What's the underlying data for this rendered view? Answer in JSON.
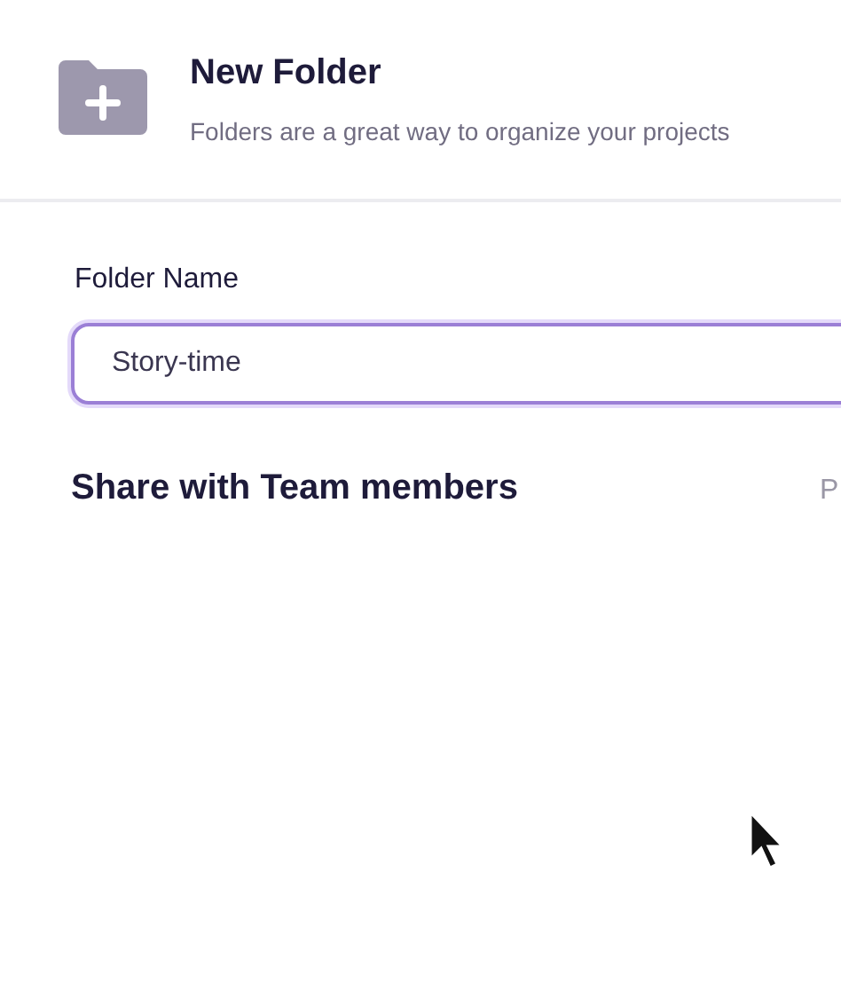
{
  "header": {
    "title": "New Folder",
    "subtitle": "Folders are a great way to organize your projects"
  },
  "folder_name": {
    "label": "Folder Name",
    "value": "Story-time",
    "focused": true
  },
  "share": {
    "title": "Share with Team members",
    "column_2": "P"
  }
}
